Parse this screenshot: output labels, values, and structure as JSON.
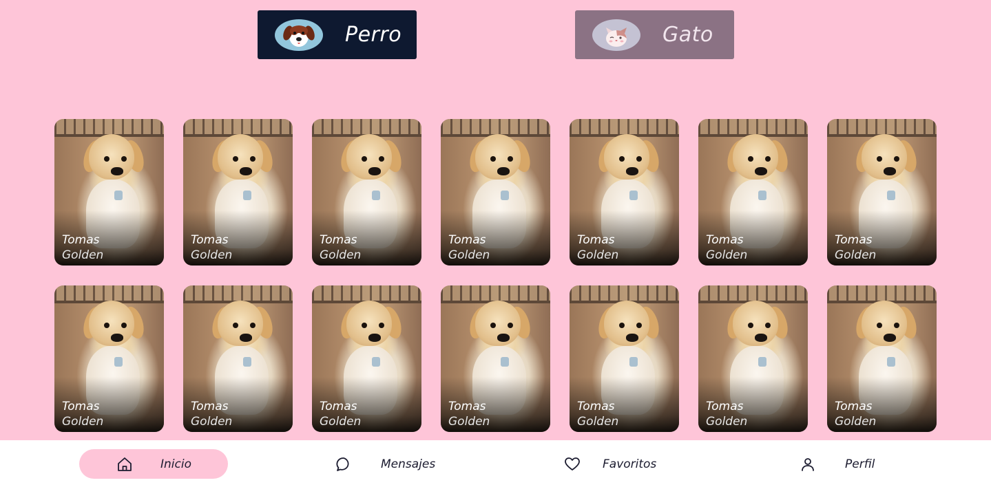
{
  "categories": [
    {
      "label": "Perro",
      "icon": "dog-face-icon",
      "selected": true
    },
    {
      "label": "Gato",
      "icon": "cat-face-icon",
      "selected": false
    }
  ],
  "pets": [
    {
      "name": "Tomas",
      "breed": "Golden"
    },
    {
      "name": "Tomas",
      "breed": "Golden"
    },
    {
      "name": "Tomas",
      "breed": "Golden"
    },
    {
      "name": "Tomas",
      "breed": "Golden"
    },
    {
      "name": "Tomas",
      "breed": "Golden"
    },
    {
      "name": "Tomas",
      "breed": "Golden"
    },
    {
      "name": "Tomas",
      "breed": "Golden"
    },
    {
      "name": "Tomas",
      "breed": "Golden"
    },
    {
      "name": "Tomas",
      "breed": "Golden"
    },
    {
      "name": "Tomas",
      "breed": "Golden"
    },
    {
      "name": "Tomas",
      "breed": "Golden"
    },
    {
      "name": "Tomas",
      "breed": "Golden"
    },
    {
      "name": "Tomas",
      "breed": "Golden"
    },
    {
      "name": "Tomas",
      "breed": "Golden"
    }
  ],
  "nav": {
    "items": [
      {
        "label": "Inicio",
        "icon": "home-icon",
        "active": true
      },
      {
        "label": "Mensajes",
        "icon": "chat-bubble-icon",
        "active": false
      },
      {
        "label": "Favoritos",
        "icon": "heart-icon",
        "active": false
      },
      {
        "label": "Perfil",
        "icon": "user-icon",
        "active": false
      }
    ]
  },
  "colors": {
    "background": "#fec5d8",
    "dog_button": "#0e1930",
    "cat_button": "#8b7284",
    "nav_active": "#fec5d8"
  }
}
